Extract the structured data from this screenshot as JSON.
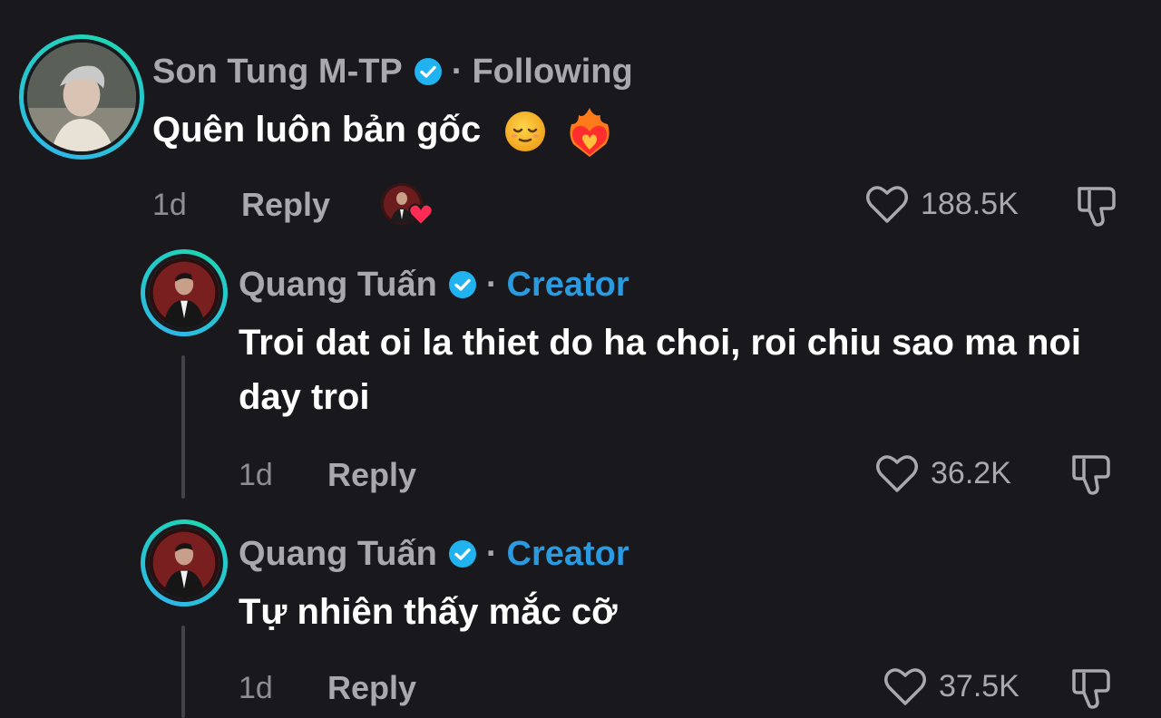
{
  "comments": [
    {
      "author": "Son Tung M-TP",
      "status": "Following",
      "text": "Quên luôn bản gốc",
      "emojis": [
        "relieved-face-emoji",
        "heart-on-fire-emoji"
      ],
      "time": "1d",
      "reply_label": "Reply",
      "likes": "188.5K",
      "creator_liked": true
    },
    {
      "author": "Quang Tuấn",
      "status": "Creator",
      "text": "Troi dat oi la thiet do ha choi, roi chiu sao ma noi day troi",
      "time": "1d",
      "reply_label": "Reply",
      "likes": "36.2K"
    },
    {
      "author": "Quang Tuấn",
      "status": "Creator",
      "text": "Tự nhiên thấy mắc cỡ",
      "time": "1d",
      "reply_label": "Reply",
      "likes": "37.5K"
    }
  ],
  "separator": "·",
  "colors": {
    "background": "#19181d",
    "creator": "#2a9be0",
    "verified": "#20b3f0",
    "muted": "#a9a8ad",
    "liked_heart": "#fe2c55"
  }
}
